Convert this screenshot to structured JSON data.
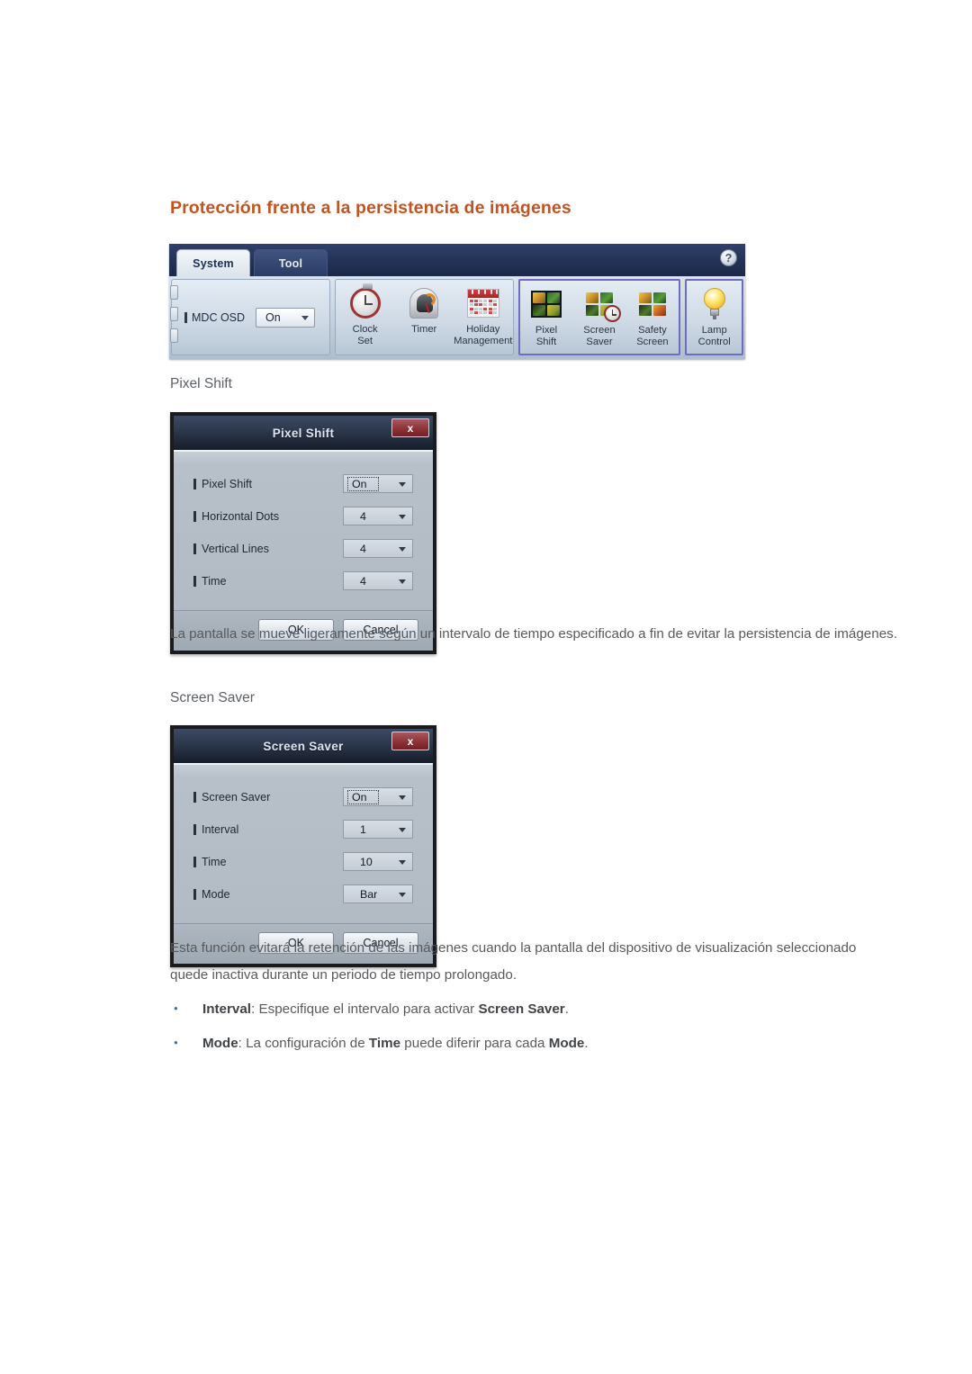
{
  "page": {
    "section_title": "Protección frente a la persistencia de imágenes",
    "accent_color": "#c4531f"
  },
  "toolbar": {
    "tabs": [
      {
        "label": "System",
        "active": true
      },
      {
        "label": "Tool",
        "active": false
      }
    ],
    "help_icon": "?",
    "osd_group": {
      "label": "MDC OSD",
      "value": "On"
    },
    "time_group": [
      {
        "line1": "Clock",
        "line2": "Set",
        "icon": "clock-icon"
      },
      {
        "line1": "Timer",
        "line2": "",
        "icon": "timer-icon"
      },
      {
        "line1": "Holiday",
        "line2": "Management",
        "icon": "calendar-icon"
      }
    ],
    "protection_group": [
      {
        "line1": "Pixel",
        "line2": "Shift",
        "icon": "pixel-shift-icon"
      },
      {
        "line1": "Screen",
        "line2": "Saver",
        "icon": "screen-saver-icon"
      },
      {
        "line1": "Safety",
        "line2": "Screen",
        "icon": "safety-screen-icon"
      }
    ],
    "lamp_group": [
      {
        "line1": "Lamp",
        "line2": "Control",
        "icon": "lamp-icon"
      }
    ],
    "highlight_color": "#6f6bc0"
  },
  "pixel_shift": {
    "heading": "Pixel Shift",
    "dialog": {
      "title": "Pixel Shift",
      "close_label": "x",
      "rows": [
        {
          "label": "Pixel Shift",
          "value": "On",
          "focused": true
        },
        {
          "label": "Horizontal Dots",
          "value": "4",
          "focused": false
        },
        {
          "label": "Vertical Lines",
          "value": "4",
          "focused": false
        },
        {
          "label": "Time",
          "value": "4",
          "focused": false
        }
      ],
      "ok_label": "OK",
      "cancel_label": "Cancel"
    },
    "description": "La pantalla se mueve ligeramente según un intervalo de tiempo especificado a fin de evitar la persistencia de imágenes."
  },
  "screen_saver": {
    "heading": "Screen Saver",
    "dialog": {
      "title": "Screen Saver",
      "close_label": "x",
      "rows": [
        {
          "label": "Screen Saver",
          "value": "On",
          "focused": true
        },
        {
          "label": "Interval",
          "value": "1",
          "focused": false
        },
        {
          "label": "Time",
          "value": "10",
          "focused": false
        },
        {
          "label": "Mode",
          "value": "Bar",
          "focused": false
        }
      ],
      "ok_label": "OK",
      "cancel_label": "Cancel"
    },
    "description": "Esta función evitará la retención de las imágenes cuando la pantalla del dispositivo de visualización seleccionado quede inactiva durante un periodo de tiempo prolongado.",
    "bullets": [
      {
        "parts": [
          {
            "text": "Interval",
            "bold": true
          },
          {
            "text": ": Especifique el intervalo para activar ",
            "bold": false
          },
          {
            "text": "Screen Saver",
            "bold": true
          },
          {
            "text": ".",
            "bold": false
          }
        ]
      },
      {
        "parts": [
          {
            "text": "Mode",
            "bold": true
          },
          {
            "text": ": La configuración de ",
            "bold": false
          },
          {
            "text": "Time",
            "bold": true
          },
          {
            "text": " puede diferir para cada ",
            "bold": false
          },
          {
            "text": "Mode",
            "bold": true
          },
          {
            "text": ".",
            "bold": false
          }
        ]
      }
    ]
  }
}
